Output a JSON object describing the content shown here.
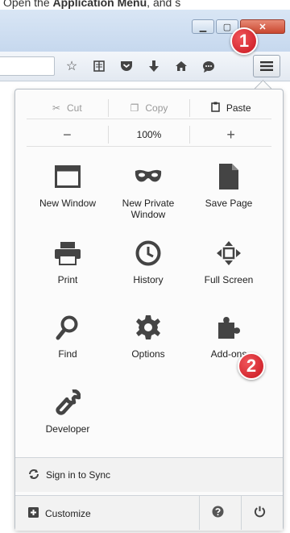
{
  "caption": {
    "prefix": "Open the ",
    "bold": "Application Menu",
    "suffix": ", and s"
  },
  "toolbar": {
    "icons": [
      "star-icon",
      "reading-list-icon",
      "pocket-icon",
      "download-icon",
      "home-icon",
      "chat-icon"
    ],
    "menu_button": "hamburger-menu-icon"
  },
  "badges": [
    "1",
    "2"
  ],
  "menu": {
    "edit": {
      "cut": "Cut",
      "copy": "Copy",
      "paste": "Paste"
    },
    "zoom": {
      "minus": "−",
      "level": "100%",
      "plus": "+"
    },
    "items": [
      {
        "label": "New Window"
      },
      {
        "label": "New Private Window"
      },
      {
        "label": "Save Page"
      },
      {
        "label": "Print"
      },
      {
        "label": "History"
      },
      {
        "label": "Full Screen"
      },
      {
        "label": "Find"
      },
      {
        "label": "Options"
      },
      {
        "label": "Add-ons"
      },
      {
        "label": "Developer"
      }
    ],
    "sync": "Sign in to Sync",
    "customize": "Customize"
  },
  "colors": {
    "badge": "#d21f27",
    "accent": "#4a6ea8"
  }
}
